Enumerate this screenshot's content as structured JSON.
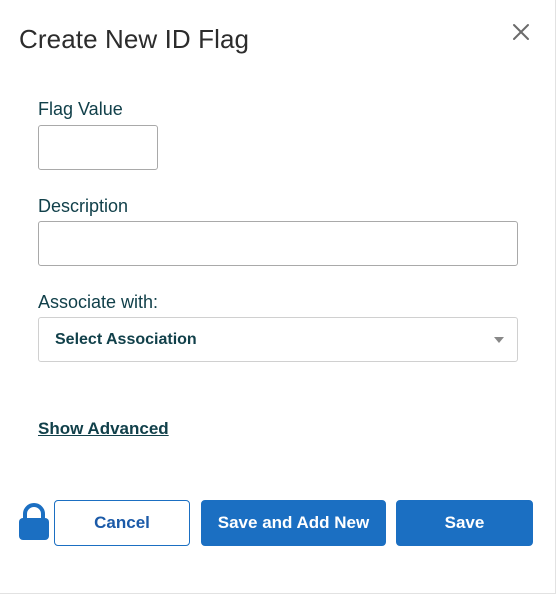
{
  "dialog": {
    "title": "Create New ID Flag",
    "close_icon": "close-icon"
  },
  "form": {
    "flag_value": {
      "label": "Flag Value",
      "value": "",
      "placeholder": ""
    },
    "description": {
      "label": "Description",
      "value": "",
      "placeholder": ""
    },
    "association": {
      "label": "Associate with:",
      "selected": "Select Association",
      "icon": "chevron-down-icon"
    },
    "advanced_link": "Show Advanced"
  },
  "footer": {
    "lock_icon": "lock-icon",
    "cancel_label": "Cancel",
    "save_and_new_label": "Save and Add New",
    "save_label": "Save"
  },
  "colors": {
    "primary": "#1b6fc2",
    "label_text": "#11404a",
    "title_text": "#2c2c2c"
  }
}
